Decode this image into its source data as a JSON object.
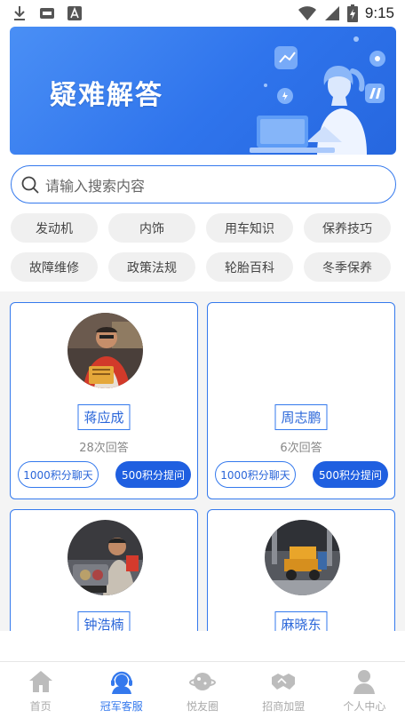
{
  "status_bar": {
    "time": "9:15",
    "left_icons": [
      "download-icon",
      "media-icon",
      "font-icon"
    ],
    "right_icons": [
      "wifi-icon",
      "signal-icon",
      "battery-charging-icon"
    ]
  },
  "banner": {
    "title": "疑难解答"
  },
  "search": {
    "placeholder": "请输入搜索内容"
  },
  "tags": [
    "发动机",
    "内饰",
    "用车知识",
    "保养技巧",
    "故障维修",
    "政策法规",
    "轮胎百科",
    "冬季保养"
  ],
  "experts": [
    {
      "name": "蒋应成",
      "answers": "28次回答",
      "chat_label": "1000积分聊天",
      "ask_label": "500积分提问",
      "has_avatar": true
    },
    {
      "name": "周志鹏",
      "answers": "6次回答",
      "chat_label": "1000积分聊天",
      "ask_label": "500积分提问",
      "has_avatar": false
    },
    {
      "name": "钟浩楠",
      "has_avatar": true
    },
    {
      "name": "麻晓东",
      "has_avatar": true
    }
  ],
  "bottom_nav": [
    {
      "label": "首页",
      "icon": "home-icon",
      "active": false
    },
    {
      "label": "冠军客服",
      "icon": "customer-service-icon",
      "active": true
    },
    {
      "label": "悦友圈",
      "icon": "planet-icon",
      "active": false
    },
    {
      "label": "招商加盟",
      "icon": "handshake-icon",
      "active": false
    },
    {
      "label": "个人中心",
      "icon": "person-icon",
      "active": false
    }
  ],
  "colors": {
    "accent": "#3479ed",
    "accent_dark": "#1f5fe0",
    "nav_inactive": "#bcbcbc"
  }
}
